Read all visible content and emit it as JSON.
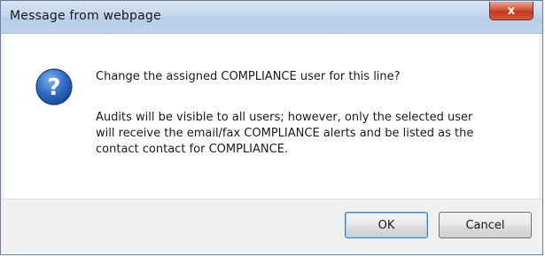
{
  "window": {
    "title": "Message from webpage",
    "close_label": "x"
  },
  "message": {
    "question": "Change the assigned COMPLIANCE user for this line?",
    "detail": "Audits will be visible to all users; however, only the selected user will receive the email/fax COMPLIANCE alerts and be listed as the contact contact for COMPLIANCE."
  },
  "buttons": {
    "ok_label": "OK",
    "cancel_label": "Cancel"
  },
  "icon": {
    "name": "question-icon",
    "glyph": "?",
    "color": "#2f6bc6"
  }
}
